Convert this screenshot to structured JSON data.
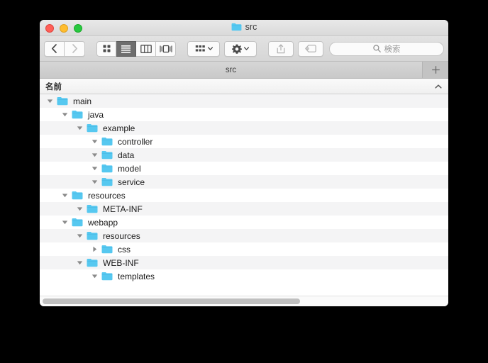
{
  "window": {
    "title": "src",
    "title_icon": "folder-icon",
    "traffic_lights": [
      {
        "name": "close-button",
        "color": "#ff5f57"
      },
      {
        "name": "minimize-button",
        "color": "#ffbd2e"
      },
      {
        "name": "maximize-button",
        "color": "#28c840"
      }
    ]
  },
  "toolbar": {
    "back_label": "‹",
    "forward_label": "›",
    "view_modes": [
      {
        "name": "icon-view",
        "icon": "grid-icon",
        "active": false
      },
      {
        "name": "list-view",
        "icon": "list-icon",
        "active": true
      },
      {
        "name": "column-view",
        "icon": "columns-icon",
        "active": false
      },
      {
        "name": "gallery-view",
        "icon": "gallery-icon",
        "active": false
      }
    ],
    "arrange_icon": "arrange-grid-icon",
    "action_icon": "gear-icon",
    "share_icon": "share-icon",
    "tags_icon": "tag-icon"
  },
  "search": {
    "placeholder": "検索",
    "value": "",
    "icon": "search-icon"
  },
  "tabs": {
    "items": [
      {
        "label": "src",
        "active": true
      }
    ],
    "new_tab_label": "+"
  },
  "column_header": {
    "name_label": "名前",
    "sort_direction": "ascending"
  },
  "files": [
    {
      "label": "main",
      "depth": 0,
      "expanded": true,
      "icon": "folder-icon"
    },
    {
      "label": "java",
      "depth": 1,
      "expanded": true,
      "icon": "folder-icon"
    },
    {
      "label": "example",
      "depth": 2,
      "expanded": true,
      "icon": "folder-icon"
    },
    {
      "label": "controller",
      "depth": 3,
      "expanded": true,
      "icon": "folder-icon"
    },
    {
      "label": "data",
      "depth": 3,
      "expanded": true,
      "icon": "folder-icon"
    },
    {
      "label": "model",
      "depth": 3,
      "expanded": true,
      "icon": "folder-icon"
    },
    {
      "label": "service",
      "depth": 3,
      "expanded": true,
      "icon": "folder-icon"
    },
    {
      "label": "resources",
      "depth": 1,
      "expanded": true,
      "icon": "folder-icon"
    },
    {
      "label": "META-INF",
      "depth": 2,
      "expanded": true,
      "icon": "folder-icon"
    },
    {
      "label": "webapp",
      "depth": 1,
      "expanded": true,
      "icon": "folder-icon"
    },
    {
      "label": "resources",
      "depth": 2,
      "expanded": true,
      "icon": "folder-icon"
    },
    {
      "label": "css",
      "depth": 3,
      "expanded": false,
      "icon": "folder-icon"
    },
    {
      "label": "WEB-INF",
      "depth": 2,
      "expanded": true,
      "icon": "folder-icon"
    },
    {
      "label": "templates",
      "depth": 3,
      "expanded": true,
      "icon": "folder-icon"
    }
  ],
  "scrollbar": {
    "horizontal_thumb_percent": 63
  },
  "colors": {
    "folder": "#56c8f0",
    "folder_tab": "#4bbde8",
    "row_stripe": "#f4f4f5",
    "window_chrome": "#d9d9d9"
  }
}
